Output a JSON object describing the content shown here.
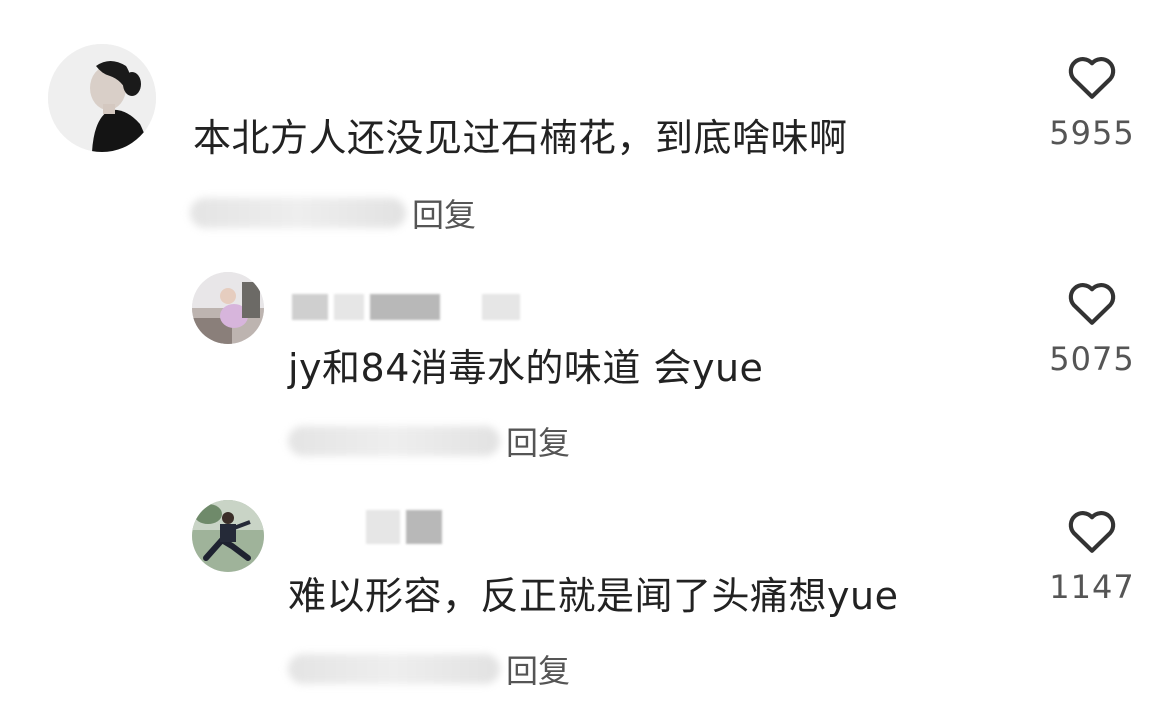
{
  "comments": [
    {
      "text": "本北方人还没见过石楠花，到底啥味啊",
      "reply_label": "回复",
      "likes": "5955",
      "icons": {
        "like": "heart-outline-icon"
      }
    },
    {
      "text": "jy和84消毒水的味道 会yue",
      "reply_label": "回复",
      "likes": "5075",
      "icons": {
        "like": "heart-outline-icon"
      }
    },
    {
      "text": "难以形容，反正就是闻了头痛想yue",
      "reply_label": "回复",
      "likes": "1147",
      "icons": {
        "like": "heart-outline-icon"
      }
    }
  ],
  "colors": {
    "text": "#222222",
    "secondary_text": "#555555",
    "background": "#ffffff"
  }
}
